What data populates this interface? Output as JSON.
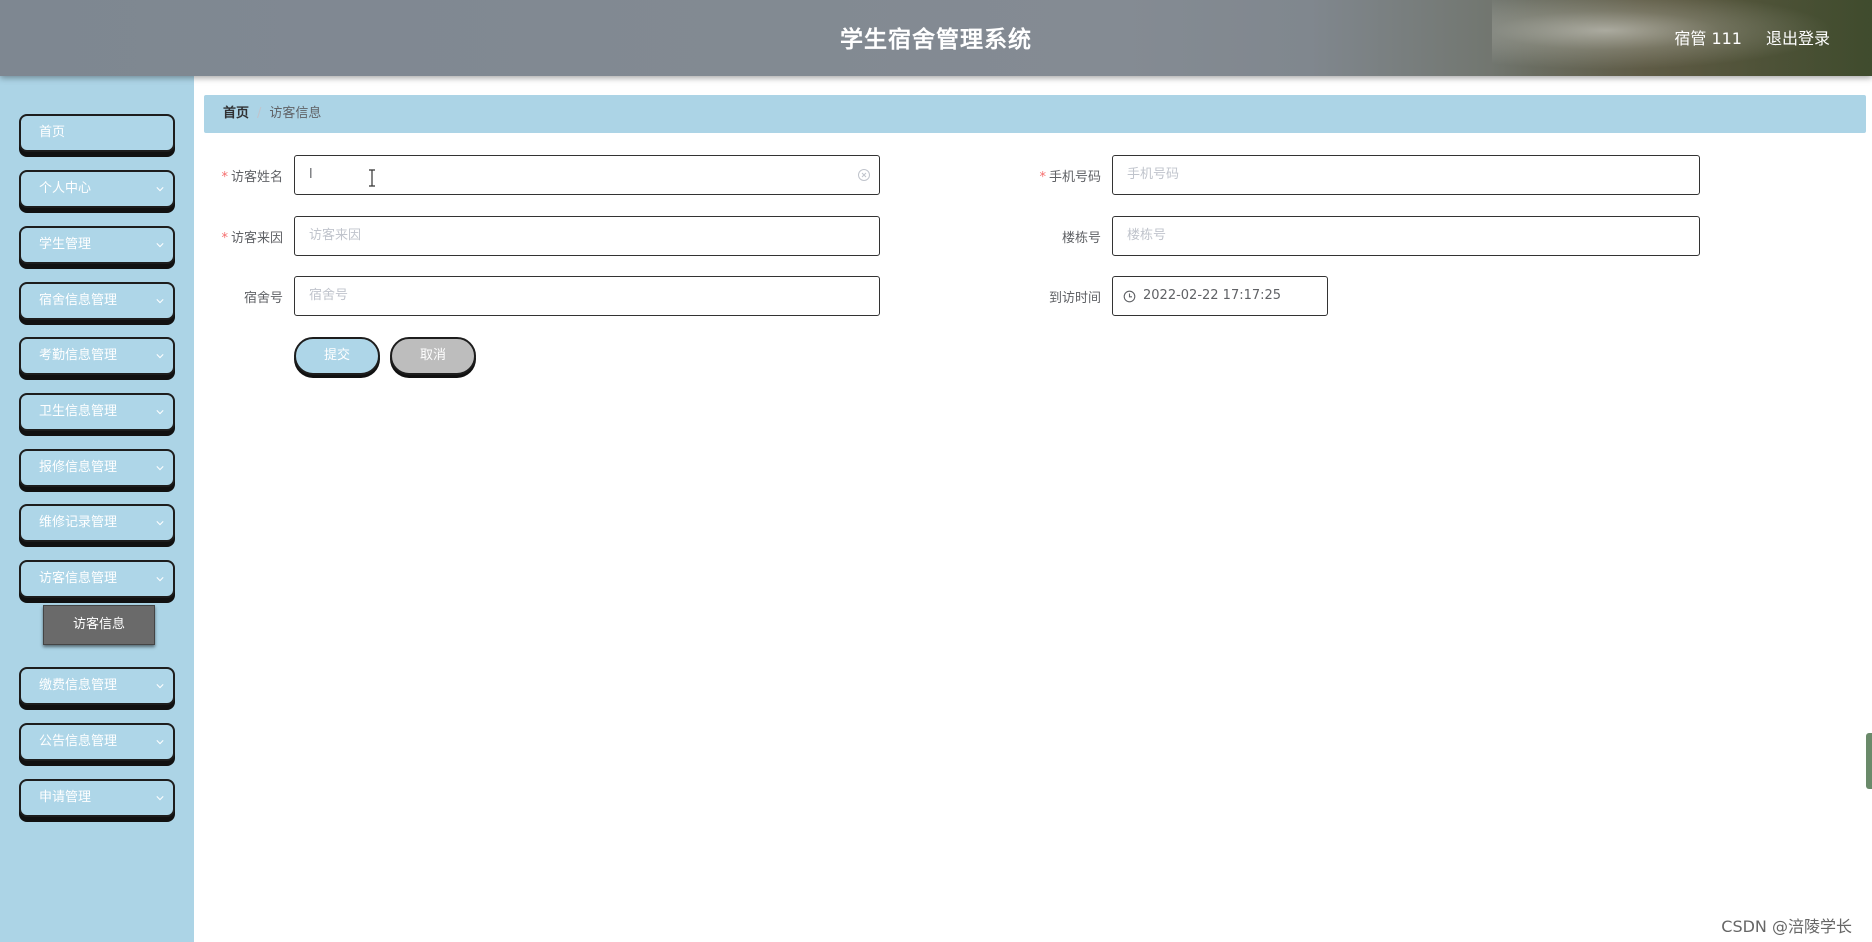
{
  "header": {
    "title": "学生宿舍管理系统",
    "user": "宿管 111",
    "logout": "退出登录"
  },
  "sidebar": {
    "items": [
      {
        "label": "首页",
        "has_arrow": false
      },
      {
        "label": "个人中心",
        "has_arrow": true
      },
      {
        "label": "学生管理",
        "has_arrow": true
      },
      {
        "label": "宿舍信息管理",
        "has_arrow": true
      },
      {
        "label": "考勤信息管理",
        "has_arrow": true
      },
      {
        "label": "卫生信息管理",
        "has_arrow": true
      },
      {
        "label": "报修信息管理",
        "has_arrow": true
      },
      {
        "label": "维修记录管理",
        "has_arrow": true
      },
      {
        "label": "访客信息管理",
        "has_arrow": true
      },
      {
        "label": "缴费信息管理",
        "has_arrow": true
      },
      {
        "label": "公告信息管理",
        "has_arrow": true
      },
      {
        "label": "申请管理",
        "has_arrow": true
      }
    ],
    "submenu_active": "访客信息"
  },
  "breadcrumb": {
    "home": "首页",
    "separator": "/",
    "current": "访客信息"
  },
  "form": {
    "visitor_name": {
      "label": "访客姓名",
      "required": true,
      "value": "l"
    },
    "phone": {
      "label": "手机号码",
      "required": true,
      "placeholder": "手机号码"
    },
    "reason": {
      "label": "访客来因",
      "required": true,
      "placeholder": "访客来因"
    },
    "building": {
      "label": "楼栋号",
      "required": false,
      "placeholder": "楼栋号"
    },
    "dorm": {
      "label": "宿舍号",
      "required": false,
      "placeholder": "宿舍号"
    },
    "visit_time": {
      "label": "到访时间",
      "required": false,
      "value": "2022-02-22 17:17:25"
    },
    "required_mark": "*"
  },
  "buttons": {
    "submit": "提交",
    "cancel": "取消"
  },
  "watermark": "CSDN @涪陵学长",
  "colors": {
    "sidebar_bg": "#acd4e6",
    "accent": "#aed6e8",
    "required": "#f56c6c",
    "submenu_active_bg": "#6a6a6a"
  }
}
